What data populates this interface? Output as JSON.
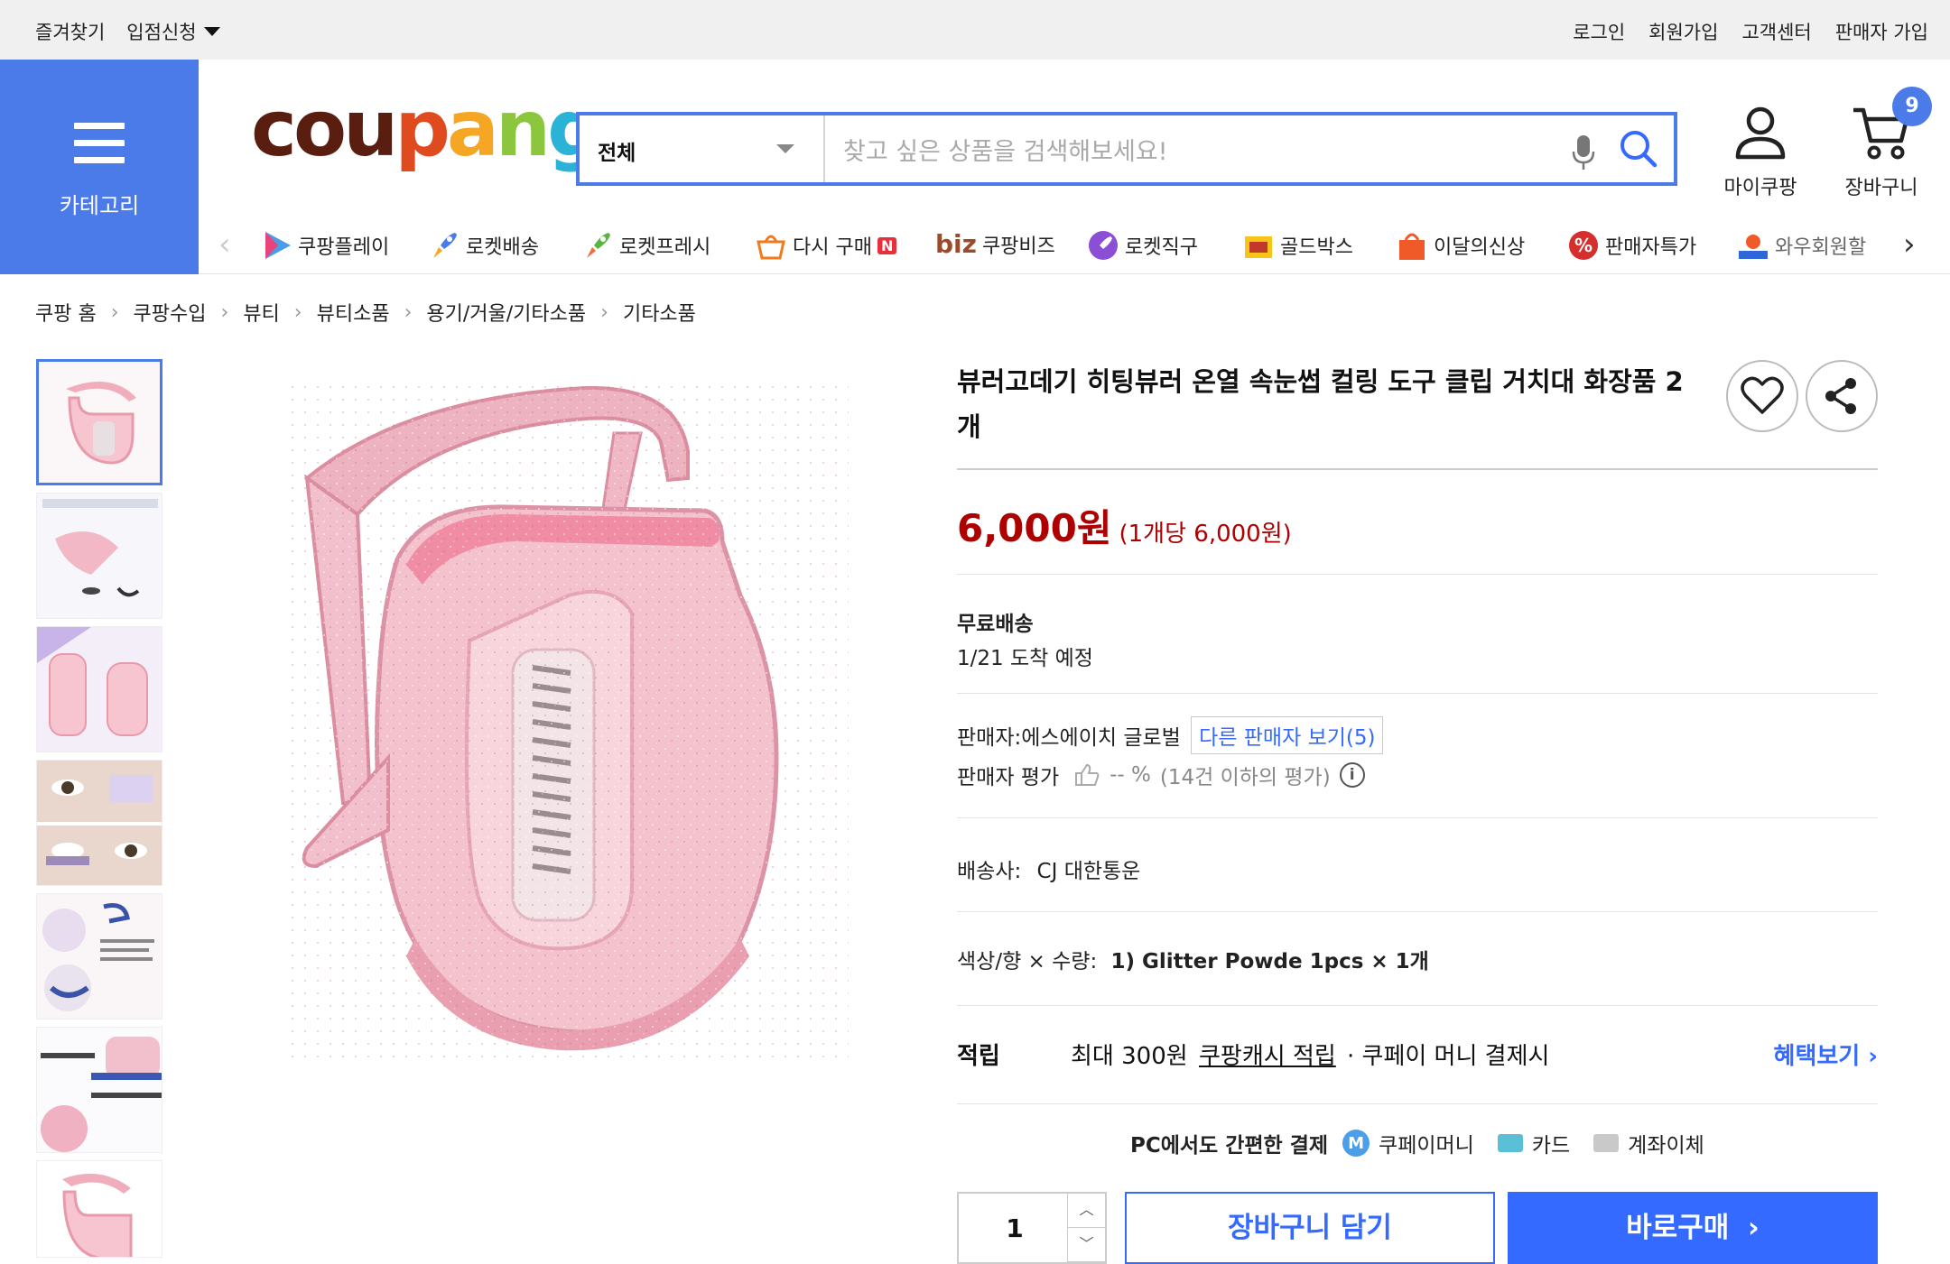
{
  "topbar": {
    "bookmark": "즐겨찾기",
    "apply": "입점신청",
    "login": "로그인",
    "signup": "회원가입",
    "support": "고객센터",
    "seller_join": "판매자 가입"
  },
  "category_label": "카테고리",
  "logo": {
    "c": "c",
    "o": "o",
    "u": "u",
    "p": "p",
    "a": "a",
    "n": "n",
    "g": "g"
  },
  "search": {
    "scope": "전체",
    "placeholder": "찾고 싶은 상품을 검색해보세요!"
  },
  "header": {
    "my_coupang": "마이쿠팡",
    "cart": "장바구니",
    "cart_count": "9"
  },
  "nav": [
    {
      "label": "쿠팡플레이",
      "icon": "play-icon"
    },
    {
      "label": "로켓배송",
      "icon": "rocket-icon"
    },
    {
      "label": "로켓프레시",
      "icon": "rocket-fresh-icon"
    },
    {
      "label": "다시 구매",
      "icon": "rebuy-icon",
      "badge": "N"
    },
    {
      "label": "쿠팡비즈",
      "icon": "biz-icon",
      "prefix": "biz"
    },
    {
      "label": "로켓직구",
      "icon": "rocket-global-icon"
    },
    {
      "label": "골드박스",
      "icon": "goldbox-icon"
    },
    {
      "label": "이달의신상",
      "icon": "new-bag-icon"
    },
    {
      "label": "판매자특가",
      "icon": "percent-icon"
    },
    {
      "label": "와우회원할",
      "icon": "wow-icon"
    }
  ],
  "breadcrumb": [
    "쿠팡 홈",
    "쿠팡수입",
    "뷰티",
    "뷰티소품",
    "용기/거울/기타소품",
    "기타소품"
  ],
  "product": {
    "title": "뷰러고데기 히팅뷰러 온열 속눈썹 컬링 도구 클립 거치대 화장품 2개",
    "price": "6,000원",
    "unit_price": "(1개당 6,000원)",
    "shipping": "무료배송",
    "arrival": "1/21 도착 예정",
    "seller_label": "판매자:에스에이치 글로벌",
    "other_sellers": "다른 판매자 보기(5)",
    "seller_rating_label": "판매자 평가",
    "seller_rating_value": "-- %",
    "seller_rating_note": "(14건 이하의 평가)",
    "carrier_label": "배송사:",
    "carrier": "CJ 대한통운",
    "option_label": "색상/향 × 수량:",
    "option": "1) Glitter Powde 1pcs × 1개"
  },
  "reward": {
    "label": "적립",
    "max": "최대 300원",
    "cash_link": "쿠팡캐시 적립",
    "note": "· 쿠페이 머니 결제시",
    "benefit": "혜택보기"
  },
  "payment": {
    "headline": "PC에서도 간편한 결제",
    "coupay": "쿠페이머니",
    "card": "카드",
    "bank": "계좌이체"
  },
  "purchase": {
    "quantity": "1",
    "add_to_cart": "장바구니 담기",
    "buy_now": "바로구매"
  },
  "colors": {
    "brand_blue": "#4a7be8",
    "accent_blue": "#346aff",
    "price_red": "#ae0000"
  }
}
